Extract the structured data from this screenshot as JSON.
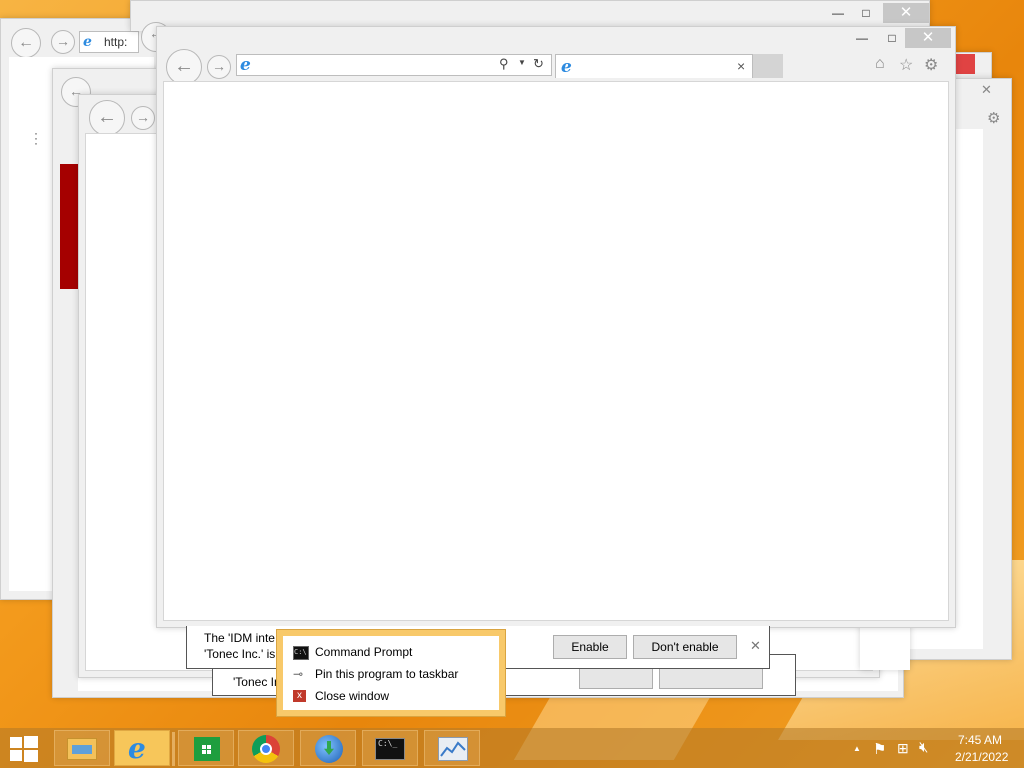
{
  "browser_windows": {
    "back_window_1": {
      "address_text": "http:"
    },
    "back_window_2": {
      "address_text": ""
    }
  },
  "main_window": {
    "address_value": "",
    "tab_title": "",
    "tab_close": "×",
    "window_controls": {
      "minimize": "—",
      "maximize": "□",
      "close": "✕"
    }
  },
  "back_window_controls": {
    "minimize": "—",
    "maximize": "□",
    "close": "✕"
  },
  "notification": {
    "message_line1": "The 'IDM inte",
    "message_line2": "'Tonec Inc.' is",
    "rear_message_line2": "'Tonec In",
    "enable_label": "Enable",
    "dont_enable_label": "Don't enable",
    "close_label": "✕"
  },
  "context_menu": {
    "items": [
      {
        "label": "Command Prompt",
        "icon": "cmd-icon"
      },
      {
        "label": "Pin this program to taskbar",
        "icon": "pin-icon"
      },
      {
        "label": "Close window",
        "icon": "close-window-icon"
      }
    ]
  },
  "taskbar": {
    "apps": [
      {
        "name": "Start",
        "icon": "windows-start-icon"
      },
      {
        "name": "File Explorer",
        "icon": "file-explorer-icon"
      },
      {
        "name": "Internet Explorer",
        "icon": "internet-explorer-icon"
      },
      {
        "name": "Store",
        "icon": "store-icon"
      },
      {
        "name": "Google Chrome",
        "icon": "chrome-icon"
      },
      {
        "name": "Internet Download Manager",
        "icon": "idm-icon"
      },
      {
        "name": "Command Prompt",
        "icon": "cmd-icon"
      },
      {
        "name": "Resource Monitor",
        "icon": "resource-monitor-icon"
      }
    ],
    "tray": {
      "time": "7:45 AM",
      "date": "2/21/2022",
      "chevron": "▲"
    }
  },
  "colors": {
    "ie_blue": "#2d8be0",
    "active_taskbar_item": "#f7c65a",
    "close_red": "#e04343",
    "sidebar_red": "#a50000"
  }
}
